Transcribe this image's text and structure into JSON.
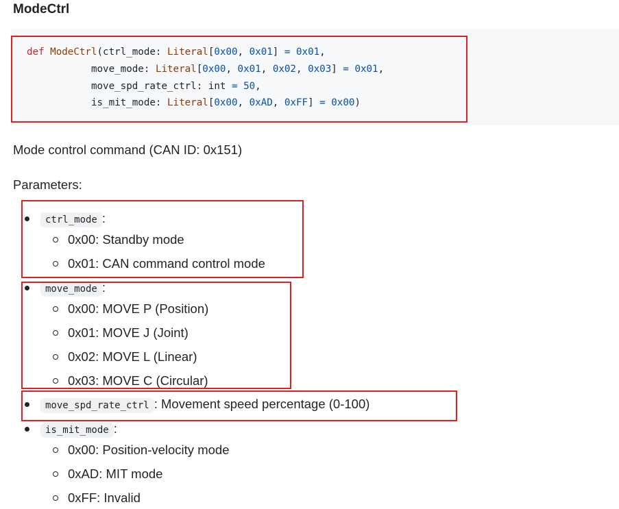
{
  "title": "ModeCtrl",
  "code": {
    "def_kw": "def",
    "fn_name": "ModeCtrl",
    "line1": {
      "param": "(ctrl_mode: ",
      "type": "Literal",
      "v1": "0x00",
      "v2": "0x01",
      "default": "0x01"
    },
    "line2": {
      "param": "move_mode: ",
      "type": "Literal",
      "v1": "0x00",
      "v2": "0x01",
      "v3": "0x02",
      "v4": "0x03",
      "default": "0x01"
    },
    "line3": {
      "param": "move_spd_rate_ctrl: ",
      "type": "int",
      "default": "50"
    },
    "line4": {
      "param": "is_mit_mode: ",
      "type": "Literal",
      "v1": "0x00",
      "v2": "0xAD",
      "v3": "0xFF",
      "default": "0x00"
    }
  },
  "description": "Mode control command (CAN ID: 0x151)",
  "params_heading": "Parameters:",
  "params": [
    {
      "name": "ctrl_mode",
      "suffix": ":",
      "options": [
        "0x00: Standby mode",
        "0x01: CAN command control mode"
      ]
    },
    {
      "name": "move_mode",
      "suffix": ":",
      "options": [
        "0x00: MOVE P (Position)",
        "0x01: MOVE J (Joint)",
        "0x02: MOVE L (Linear)",
        "0x03: MOVE C (Circular)"
      ]
    },
    {
      "name": "move_spd_rate_ctrl",
      "suffix": ": Movement speed percentage (0-100)",
      "options": []
    },
    {
      "name": "is_mit_mode",
      "suffix": ":",
      "options": [
        "0x00: Position-velocity mode",
        "0xAD: MIT mode",
        "0xFF: Invalid"
      ]
    }
  ],
  "colors": {
    "highlight_box": "#e02020",
    "code_bg": "#f6f8fa"
  }
}
